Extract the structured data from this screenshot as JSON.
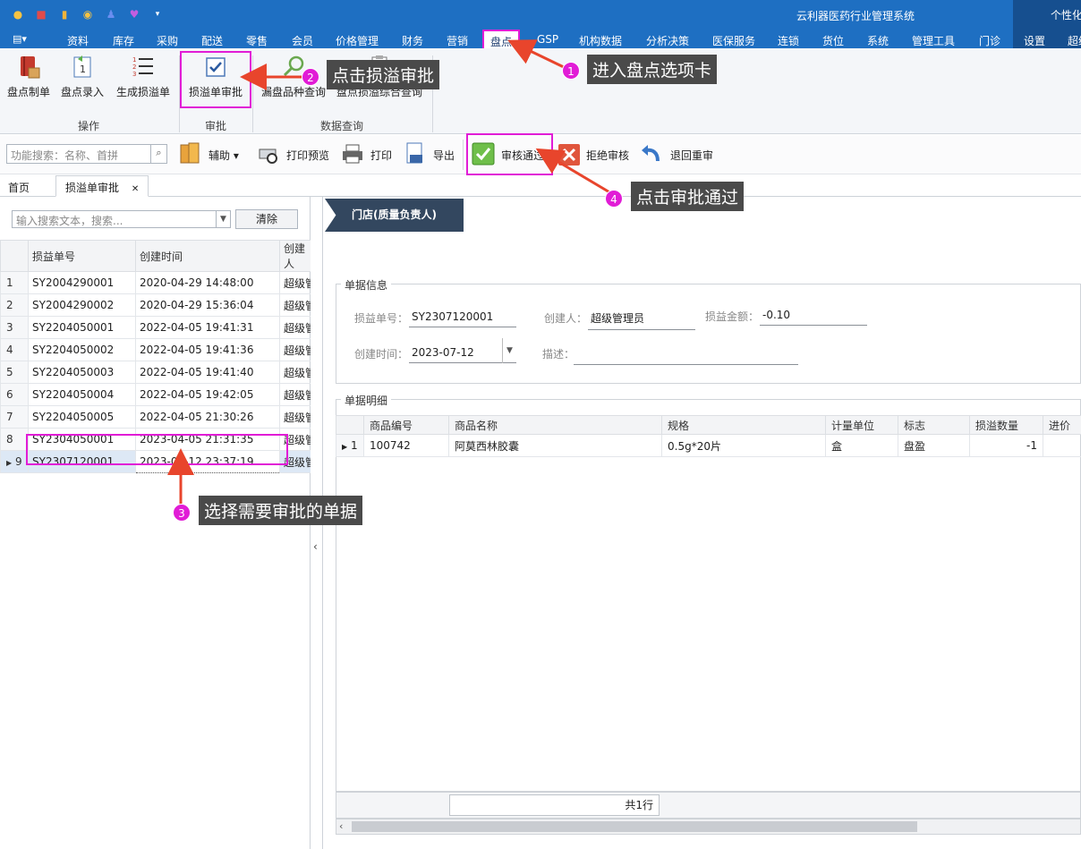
{
  "app": {
    "title": "云利器医药行业管理系统",
    "corner_text": "个性化",
    "system_menu_glyph": "▤▾"
  },
  "menu": {
    "tabs": [
      {
        "label": "资料"
      },
      {
        "label": "库存"
      },
      {
        "label": "采购"
      },
      {
        "label": "配送"
      },
      {
        "label": "零售"
      },
      {
        "label": "会员"
      },
      {
        "label": "价格管理"
      },
      {
        "label": "财务"
      },
      {
        "label": "营销"
      },
      {
        "label": "盘点"
      },
      {
        "label": "GSP"
      },
      {
        "label": "机构数据"
      },
      {
        "label": "分析决策"
      },
      {
        "label": "医保服务"
      },
      {
        "label": "连锁"
      },
      {
        "label": "货位"
      },
      {
        "label": "系统"
      },
      {
        "label": "管理工具"
      },
      {
        "label": "门诊"
      },
      {
        "label": "设置"
      },
      {
        "label": "超级"
      }
    ],
    "active": "盘点"
  },
  "ribbon": {
    "buttons": {
      "count_doc": "盘点制单",
      "count_entry": "盘点录入",
      "gen_loss": "生成损溢单",
      "loss_approve": "损溢单审批",
      "missed_query": "漏盘品种查询",
      "loss_summary": "盘点损溢综合查询"
    },
    "groups": {
      "ops": "操作",
      "approve": "审批",
      "query": "数据查询"
    }
  },
  "toolbar": {
    "search_placeholder": "功能搜索：名称、首拼",
    "assist": "辅助",
    "print_preview": "打印预览",
    "print": "打印",
    "export": "导出",
    "approve_pass": "审核通过",
    "reject": "拒绝审核",
    "return": "退回重审"
  },
  "doctabs": {
    "home": "首页",
    "current": "损溢单审批",
    "close_glyph": "✕"
  },
  "left": {
    "search_placeholder": "输入搜索文本，搜索...",
    "clear": "清除",
    "columns": [
      "损益单号",
      "创建时间",
      "创建人"
    ],
    "rows": [
      {
        "no": "1",
        "id": "SY2004290001",
        "time": "2020-04-29 14:48:00",
        "user": "超级管"
      },
      {
        "no": "2",
        "id": "SY2004290002",
        "time": "2020-04-29 15:36:04",
        "user": "超级管"
      },
      {
        "no": "3",
        "id": "SY2204050001",
        "time": "2022-04-05 19:41:31",
        "user": "超级管"
      },
      {
        "no": "4",
        "id": "SY2204050002",
        "time": "2022-04-05 19:41:36",
        "user": "超级管"
      },
      {
        "no": "5",
        "id": "SY2204050003",
        "time": "2022-04-05 19:41:40",
        "user": "超级管"
      },
      {
        "no": "6",
        "id": "SY2204050004",
        "time": "2022-04-05 19:42:05",
        "user": "超级管"
      },
      {
        "no": "7",
        "id": "SY2204050005",
        "time": "2022-04-05 21:30:26",
        "user": "超级管"
      },
      {
        "no": "8",
        "id": "SY2304050001",
        "time": "2023-04-05 21:31:35",
        "user": "超级管"
      },
      {
        "no": "9",
        "id": "SY2307120001",
        "time": "2023-07-12 23:37:19",
        "user": "超级管"
      }
    ]
  },
  "right": {
    "store": "门店(质量负责人)",
    "info_legend": "单据信息",
    "fields": {
      "loss_no_label": "损益单号：",
      "loss_no": "SY2307120001",
      "creator_label": "创建人：",
      "creator": "超级管理员",
      "amount_label": "损益金额：",
      "amount": "-0.10",
      "created_label": "创建时间：",
      "created": "2023-07-12",
      "desc_label": "描述："
    },
    "detail_legend": "单据明细",
    "detail_columns": [
      "商品编号",
      "商品名称",
      "规格",
      "计量单位",
      "标志",
      "损溢数量",
      "进价"
    ],
    "detail_rows": [
      {
        "no": "1",
        "code": "100742",
        "name": "阿莫西林胶囊",
        "spec": "0.5g*20片",
        "unit": "盒",
        "flag": "盘盈",
        "qty": "-1",
        "price": ""
      }
    ],
    "total": "共1行"
  },
  "annotations": [
    {
      "n": "1",
      "text": "进入盘点选项卡"
    },
    {
      "n": "2",
      "text": "点击损溢审批"
    },
    {
      "n": "3",
      "text": "选择需要审批的单据"
    },
    {
      "n": "4",
      "text": "点击审批通过"
    }
  ],
  "colors": {
    "titlebar": "#1e6fc2",
    "highlight": "#e11cd6",
    "callout_bg": "#4a4a4a",
    "arrow": "#e8452c"
  }
}
